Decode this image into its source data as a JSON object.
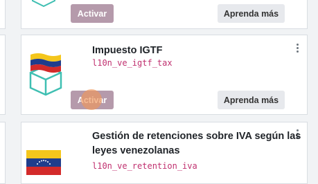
{
  "cards": {
    "top": {
      "activate_label": "Activar",
      "learn_label": "Aprenda más"
    },
    "mid": {
      "title": "Impuesto IGTF",
      "tech_name": "l10n_ve_igtf_tax",
      "activate_label": "Activar",
      "learn_label": "Aprenda más"
    },
    "bottom": {
      "title_line1": "Gestión de retenciones sobre IVA según las",
      "title_line2": "leyes venezolanas",
      "tech_name": "l10n_ve_retention_iva"
    }
  },
  "colors": {
    "activate_button": "#b59aab",
    "learn_button": "#e7e9ed",
    "tech_name": "#c0306f",
    "box_icon": "#3fbfb2"
  }
}
